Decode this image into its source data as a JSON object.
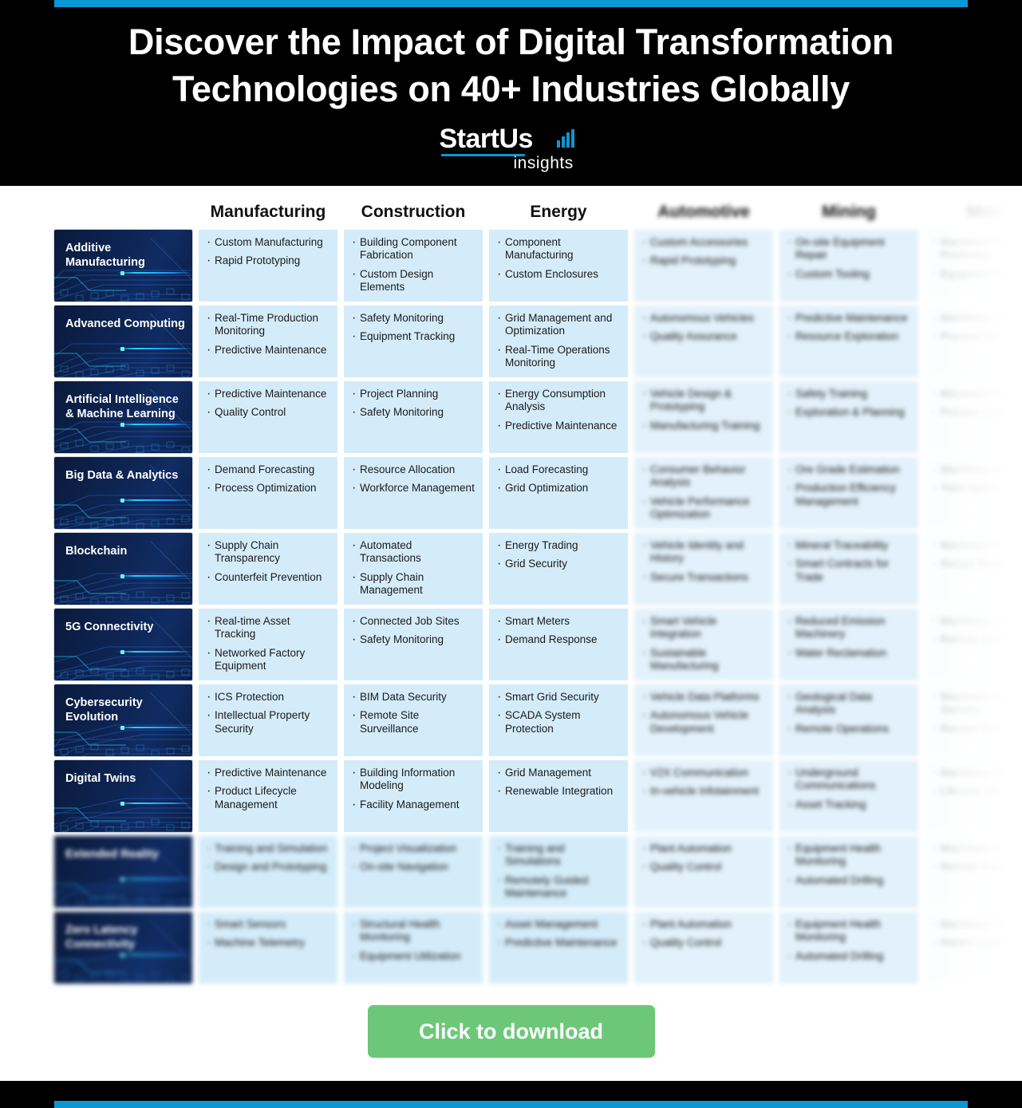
{
  "header": {
    "title_line1": "Discover the Impact of Digital Transformation",
    "title_line2": "Technologies on 40+ Industries Globally",
    "accent_color": "#0b96d4",
    "background_color": "#000000"
  },
  "logo": {
    "word": "StartUs",
    "sub": "insights",
    "bar_color": "#0b96d4"
  },
  "table": {
    "columns": [
      {
        "label": "Manufacturing",
        "state": "clear"
      },
      {
        "label": "Construction",
        "state": "clear"
      },
      {
        "label": "Energy",
        "state": "clear"
      },
      {
        "label": "Automotive",
        "state": "blurred"
      },
      {
        "label": "Mining",
        "state": "blurred"
      },
      {
        "label": "Mining",
        "state": "faded"
      }
    ],
    "rows": [
      {
        "label": "Additive Manufacturing",
        "state": "clear",
        "cells": [
          [
            "Custom Manufacturing",
            "Rapid Prototyping"
          ],
          [
            "Building Component Fabrication",
            "Custom Design Elements"
          ],
          [
            "Component Manufacturing",
            "Custom Enclosures"
          ],
          [
            "Custom Accessories",
            "Rapid Prototyping"
          ],
          [
            "On-site Equipment Repair",
            "Custom Tooling"
          ],
          [
            "Machinery Parts Production",
            "Equipment Repair"
          ]
        ]
      },
      {
        "label": "Advanced Computing",
        "state": "clear",
        "cells": [
          [
            "Real-Time Production Monitoring",
            "Predictive Maintenance"
          ],
          [
            "Safety Monitoring",
            "Equipment Tracking"
          ],
          [
            "Grid Management and Optimization",
            "Real-Time Operations Monitoring"
          ],
          [
            "Autonomous Vehicles",
            "Quality Assurance"
          ],
          [
            "Predictive Maintenance",
            "Resource Exploration"
          ],
          [
            "Machinery Optimization",
            "Process Control"
          ]
        ]
      },
      {
        "label": "Artificial Intelligence & Machine Learning",
        "state": "clear",
        "cells": [
          [
            "Predictive Maintenance",
            "Quality Control"
          ],
          [
            "Project Planning",
            "Safety Monitoring"
          ],
          [
            "Energy Consumption Analysis",
            "Predictive Maintenance"
          ],
          [
            "Vehicle Design & Prototyping",
            "Manufacturing Training"
          ],
          [
            "Safety Training",
            "Exploration & Planning"
          ],
          [
            "Machinery Diagnostics",
            "Process Control"
          ]
        ]
      },
      {
        "label": "Big Data & Analytics",
        "state": "clear",
        "cells": [
          [
            "Demand Forecasting",
            "Process Optimization"
          ],
          [
            "Resource Allocation",
            "Workforce Management"
          ],
          [
            "Load Forecasting",
            "Grid Optimization"
          ],
          [
            "Consumer Behavior Analysis",
            "Vehicle Performance Optimization"
          ],
          [
            "Ore Grade Estimation",
            "Production Efficiency Management"
          ],
          [
            "Machinery Analytics",
            "Yield Optimization"
          ]
        ]
      },
      {
        "label": "Blockchain",
        "state": "clear",
        "cells": [
          [
            "Supply Chain Transparency",
            "Counterfeit Prevention"
          ],
          [
            "Automated Transactions",
            "Supply Chain Management"
          ],
          [
            "Energy Trading",
            "Grid Security"
          ],
          [
            "Vehicle Identity and History",
            "Secure Transactions"
          ],
          [
            "Mineral Traceability",
            "Smart Contracts for Trade"
          ],
          [
            "Machinery Provenance",
            "Secure Records"
          ]
        ]
      },
      {
        "label": "5G Connectivity",
        "state": "clear",
        "cells": [
          [
            "Real-time Asset Tracking",
            "Networked Factory Equipment"
          ],
          [
            "Connected Job Sites",
            "Safety Monitoring"
          ],
          [
            "Smart Meters",
            "Demand Response"
          ],
          [
            "Smart Vehicle Integration",
            "Sustainable Manufacturing"
          ],
          [
            "Reduced Emission Machinery",
            "Water Reclamation"
          ],
          [
            "Machinery Connectivity",
            "Remote Control"
          ]
        ]
      },
      {
        "label": "Cybersecurity Evolution",
        "state": "clear",
        "cells": [
          [
            "ICS Protection",
            "Intellectual Property Security"
          ],
          [
            "BIM Data Security",
            "Remote Site Surveillance"
          ],
          [
            "Smart Grid Security",
            "SCADA System Protection"
          ],
          [
            "Vehicle Data Platforms",
            "Autonomous Vehicle Development"
          ],
          [
            "Geological Data Analysis",
            "Remote Operations"
          ],
          [
            "Machinery Data Security",
            "Remote Access"
          ]
        ]
      },
      {
        "label": "Digital Twins",
        "state": "clear",
        "cells": [
          [
            "Predictive Maintenance",
            "Product Lifecycle Management"
          ],
          [
            "Building Information Modeling",
            "Facility Management"
          ],
          [
            "Grid Management",
            "Renewable Integration"
          ],
          [
            "V2X Communication",
            "In-vehicle Infotainment"
          ],
          [
            "Underground Communications",
            "Asset Tracking"
          ],
          [
            "Machinery Simulation",
            "Lifecycle Modeling"
          ]
        ]
      },
      {
        "label": "Extended Reality",
        "state": "blurred",
        "cells": [
          [
            "Training and Simulation",
            "Design and Prototyping"
          ],
          [
            "Project Visualization",
            "On-site Navigation"
          ],
          [
            "Training and Simulations",
            "Remotely Guided Maintenance"
          ],
          [
            "Plant Automation",
            "Quality Control"
          ],
          [
            "Equipment Health Monitoring",
            "Automated Drilling"
          ],
          [
            "Machinery Training",
            "Remote Assistance"
          ]
        ]
      },
      {
        "label": "Zero Latency Connectivity",
        "state": "blurred",
        "cells": [
          [
            "Smart Sensors",
            "Machine Telemetry"
          ],
          [
            "Structural Health Monitoring",
            "Equipment Utilization"
          ],
          [
            "Asset Management",
            "Predictive Maintenance"
          ],
          [
            "Plant Automation",
            "Quality Control"
          ],
          [
            "Equipment Health Monitoring",
            "Automated Drilling"
          ],
          [
            "Machinery Telemetry",
            "Instant Control"
          ]
        ]
      }
    ]
  },
  "cta": {
    "label": "Click to download",
    "color": "#6cc878"
  },
  "footer": {
    "background_color": "#000000",
    "accent_color": "#0b96d4"
  }
}
